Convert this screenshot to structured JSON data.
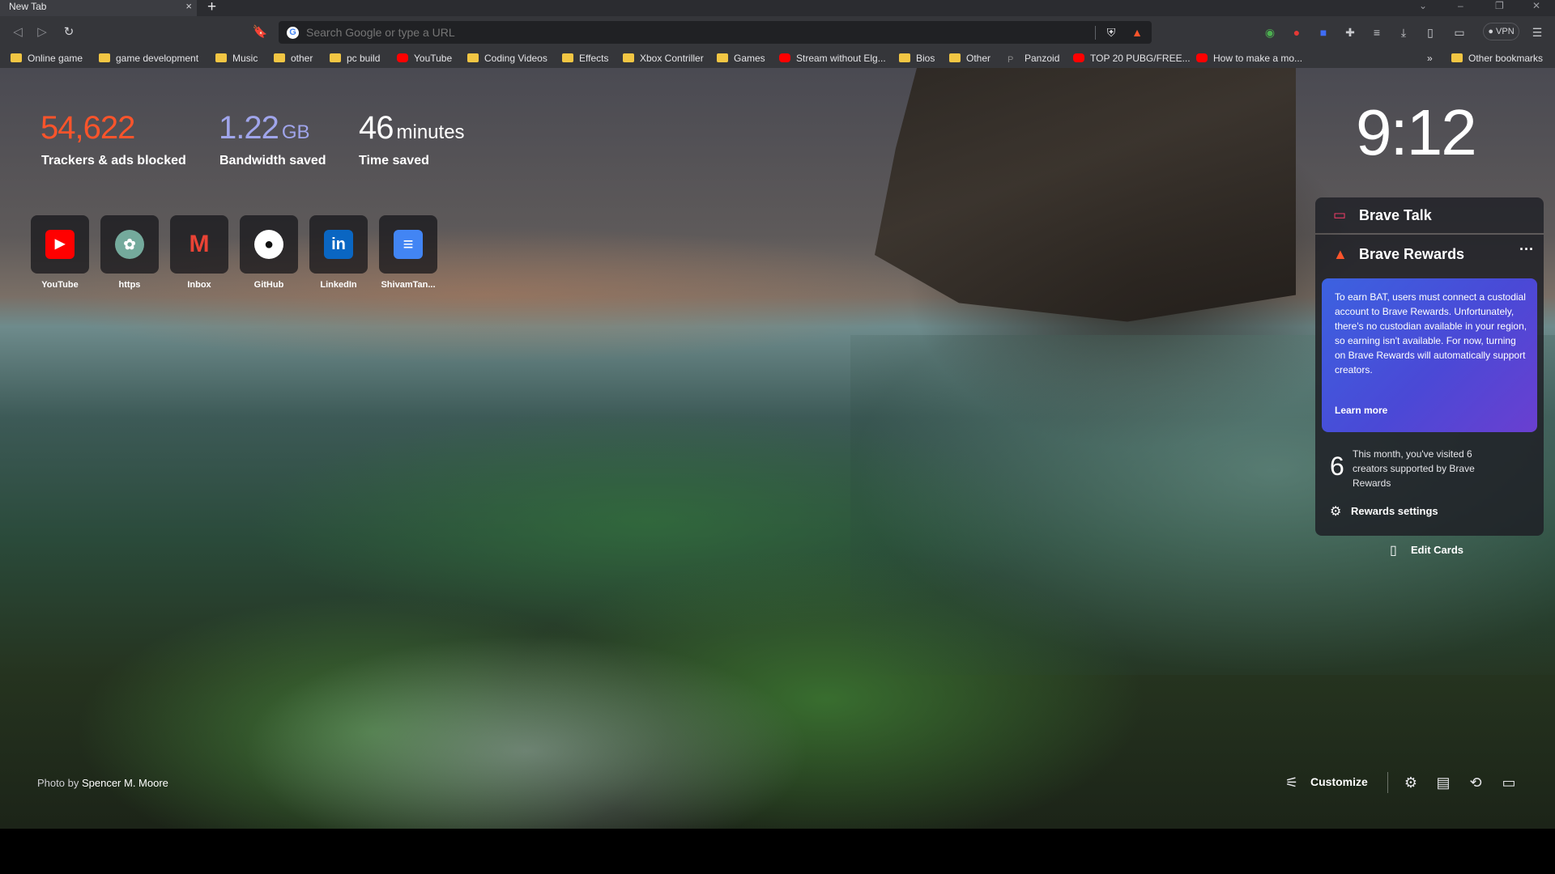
{
  "browser": {
    "tab_title": "New Tab",
    "tab_close": "×",
    "new_tab": "+",
    "omnibox_placeholder": "Search Google or type a URL",
    "vpn_label": "● VPN"
  },
  "bookmarks": [
    {
      "label": "Online game",
      "icon": "folder-icon"
    },
    {
      "label": "game development",
      "icon": "folder-icon"
    },
    {
      "label": "Music",
      "icon": "folder-icon"
    },
    {
      "label": "other",
      "icon": "folder-icon"
    },
    {
      "label": "pc build",
      "icon": "folder-icon"
    },
    {
      "label": "YouTube",
      "icon": "youtube-icon"
    },
    {
      "label": "Coding Videos",
      "icon": "folder-icon"
    },
    {
      "label": "Effects",
      "icon": "folder-icon"
    },
    {
      "label": "Xbox Contriller",
      "icon": "folder-icon"
    },
    {
      "label": "Games",
      "icon": "folder-icon"
    },
    {
      "label": "Stream without Elg...",
      "icon": "youtube-icon"
    },
    {
      "label": "Bios",
      "icon": "folder-icon"
    },
    {
      "label": "Other",
      "icon": "folder-icon"
    },
    {
      "label": "Panzoid",
      "icon": "panzoid-icon"
    },
    {
      "label": "TOP 20 PUBG/FREE...",
      "icon": "youtube-icon"
    },
    {
      "label": "How to make a mo...",
      "icon": "youtube-icon"
    }
  ],
  "bookmarks_overflow": "»",
  "other_bookmarks": "Other bookmarks",
  "stats": {
    "trackers": {
      "value": "54,622",
      "label": "Trackers & ads blocked",
      "color": "#fb542b"
    },
    "bandwidth": {
      "value": "1.22",
      "unit": "GB",
      "label": "Bandwidth saved",
      "color": "#a0a5eb"
    },
    "time": {
      "value": "46",
      "unit": "minutes",
      "label": "Time saved",
      "color": "#ffffff"
    }
  },
  "top_sites": [
    {
      "label": "YouTube",
      "icon": "youtube-icon",
      "color": "#ff0000"
    },
    {
      "label": "https",
      "icon": "chatgpt-icon",
      "color": "#74aa9c"
    },
    {
      "label": "Inbox",
      "icon": "gmail-icon",
      "color": "#ea4335"
    },
    {
      "label": "GitHub",
      "icon": "github-icon",
      "color": "#ffffff"
    },
    {
      "label": "LinkedIn",
      "icon": "linkedin-icon",
      "color": "#0a66c2"
    },
    {
      "label": "ShivamTan...",
      "icon": "docs-icon",
      "color": "#4285f4"
    }
  ],
  "clock": "9:12",
  "cards": {
    "talk_title": "Brave Talk",
    "rewards_title": "Brave Rewards",
    "rewards_menu": "···",
    "rewards_info": "To earn BAT, users must connect a custodial account to Brave Rewards. Unfortunately, there's no custodian available in your region, so earning isn't available. For now, turning on Brave Rewards will automatically support creators.",
    "learn_more": "Learn more",
    "visited_count": "6",
    "visited_text": "This month, you've visited 6 creators supported by Brave Rewards",
    "rewards_settings": "Rewards settings",
    "edit_cards": "Edit Cards"
  },
  "footer": {
    "photo_credit_prefix": "Photo by",
    "photo_credit_author": "Spencer M. Moore",
    "customize": "Customize"
  }
}
